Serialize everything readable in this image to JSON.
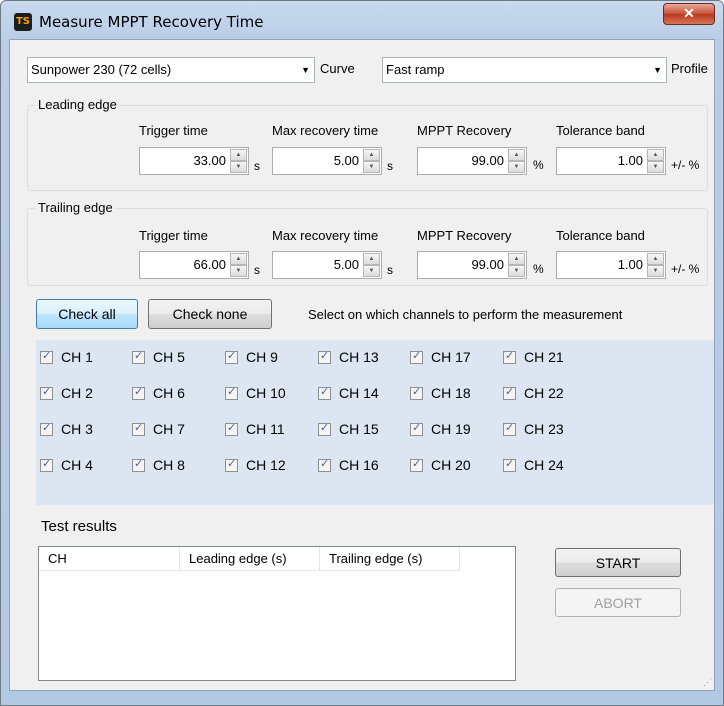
{
  "window": {
    "title": "Measure MPPT Recovery Time",
    "app_icon": "TS",
    "close_glyph": "✕"
  },
  "curve": {
    "selected": "Sunpower 230 (72 cells)",
    "label": "Curve"
  },
  "profile": {
    "selected": "Fast ramp",
    "label": "Profile"
  },
  "columns": {
    "trigger": "Trigger time",
    "max_recovery": "Max recovery time",
    "mppt": "MPPT Recovery",
    "tolerance": "Tolerance band"
  },
  "units": {
    "trigger": "s",
    "max_recovery": "s",
    "mppt": "%",
    "tolerance": "+/- %"
  },
  "leading": {
    "title": "Leading edge",
    "trigger": "33.00",
    "max_recovery": "5.00",
    "mppt": "99.00",
    "tolerance": "1.00"
  },
  "trailing": {
    "title": "Trailing edge",
    "trigger": "66.00",
    "max_recovery": "5.00",
    "mppt": "99.00",
    "tolerance": "1.00"
  },
  "buttons": {
    "check_all": "Check all",
    "check_none": "Check none",
    "start": "START",
    "abort": "ABORT"
  },
  "channels_hint": "Select on which channels to perform the measurement",
  "channels": [
    "CH 1",
    "CH 2",
    "CH 3",
    "CH 4",
    "CH 5",
    "CH 6",
    "CH 7",
    "CH 8",
    "CH 9",
    "CH 10",
    "CH 11",
    "CH 12",
    "CH 13",
    "CH 14",
    "CH 15",
    "CH 16",
    "CH 17",
    "CH 18",
    "CH 19",
    "CH 20",
    "CH 21",
    "CH 22",
    "CH 23",
    "CH 24"
  ],
  "results": {
    "title": "Test results",
    "col_ch": "CH",
    "col_leading": "Leading edge (s)",
    "col_trailing": "Trailing edge (s)"
  }
}
